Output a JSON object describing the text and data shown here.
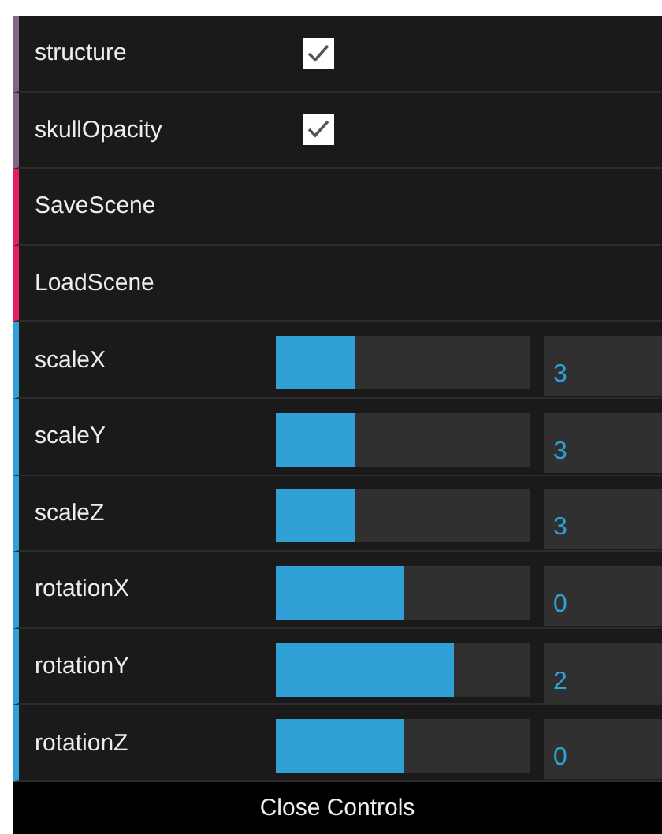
{
  "controls": [
    {
      "kind": "checkbox",
      "label": "structure",
      "checked": true
    },
    {
      "kind": "checkbox",
      "label": "skullOpacity",
      "checked": true
    },
    {
      "kind": "function",
      "label": "SaveScene"
    },
    {
      "kind": "function",
      "label": "LoadScene"
    },
    {
      "kind": "number",
      "label": "scaleX",
      "level": 0.31,
      "value": "3"
    },
    {
      "kind": "number",
      "label": "scaleY",
      "level": 0.31,
      "value": "3"
    },
    {
      "kind": "number",
      "label": "scaleZ",
      "level": 0.31,
      "value": "3"
    },
    {
      "kind": "number",
      "label": "rotationX",
      "level": 0.5,
      "value": "0"
    },
    {
      "kind": "number",
      "label": "rotationY",
      "level": 0.7,
      "value": "2"
    },
    {
      "kind": "number",
      "label": "rotationZ",
      "level": 0.5,
      "value": "0"
    }
  ],
  "close_button": "Close Controls"
}
